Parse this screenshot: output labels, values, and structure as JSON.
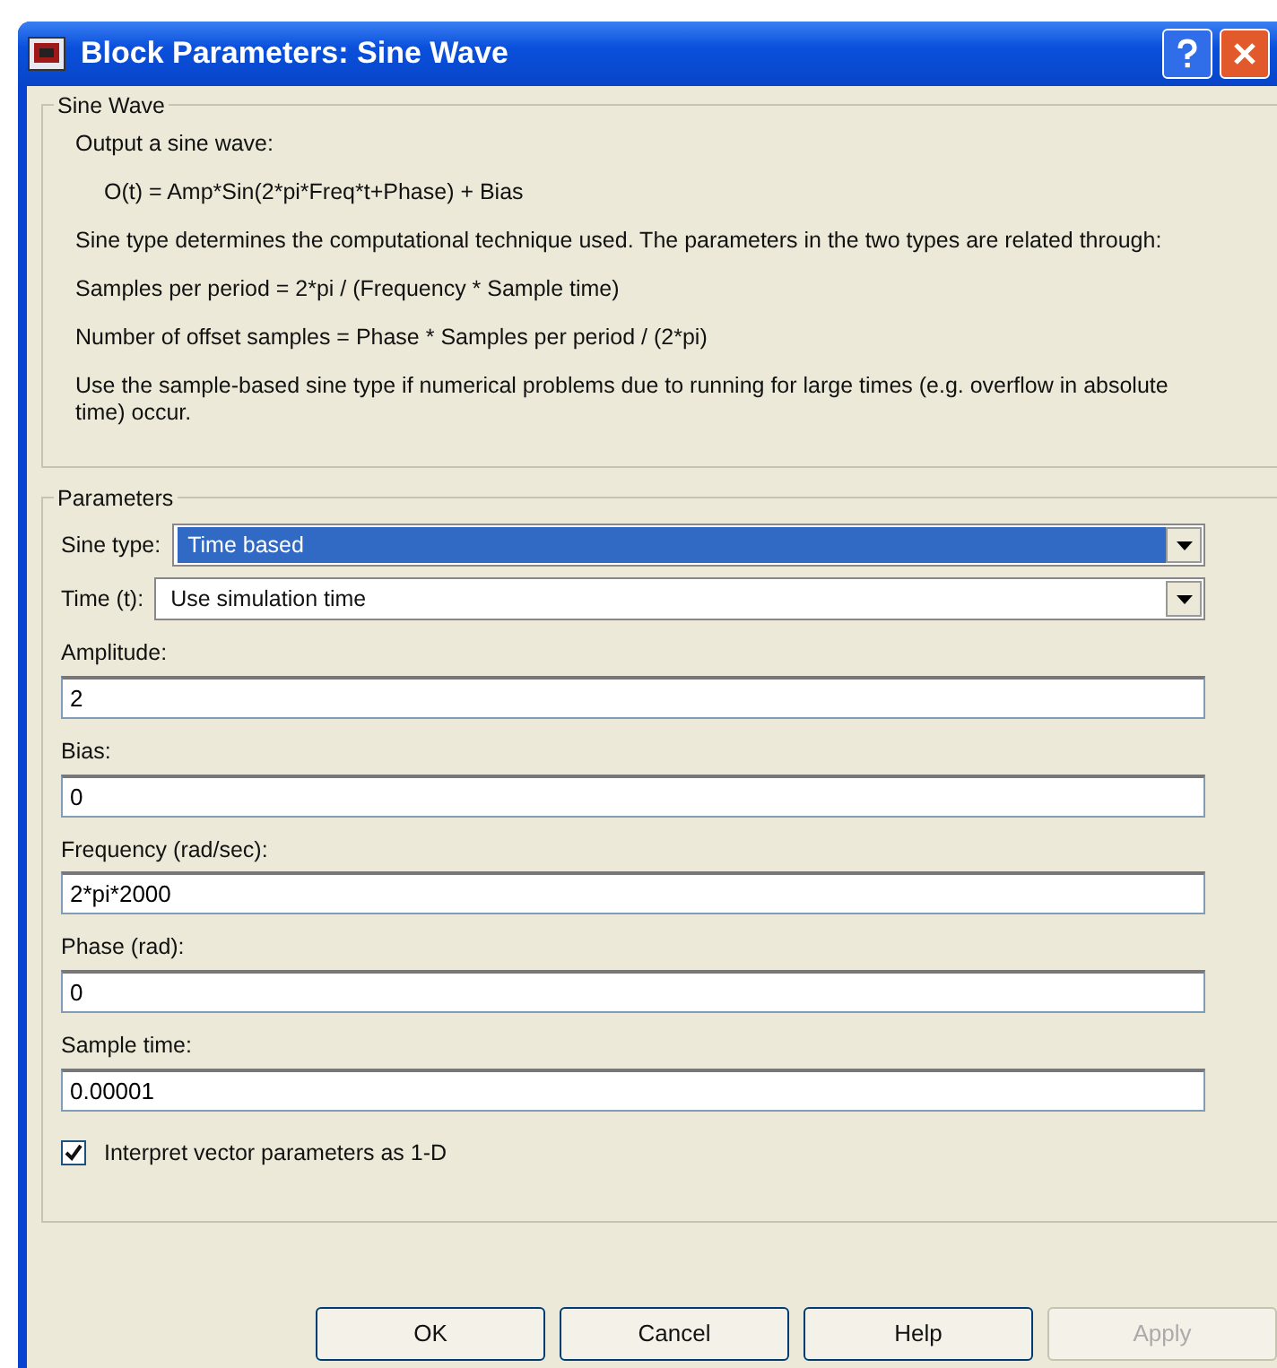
{
  "window": {
    "title": "Block Parameters: Sine Wave"
  },
  "description": {
    "title": "Sine Wave",
    "paragraphs": [
      "Output a sine wave:",
      "  O(t) = Amp*Sin(2*pi*Freq*t+Phase) + Bias",
      "Sine type determines the computational technique used. The parameters in the two types are related through:",
      "Samples per period = 2*pi / (Frequency * Sample time)",
      "Number of offset samples = Phase * Samples per period / (2*pi)",
      "Use the sample-based sine type if numerical problems due to running for large times (e.g. overflow in absolute time) occur."
    ]
  },
  "parameters": {
    "title": "Parameters",
    "items": [
      {
        "kind": "dropdown",
        "label": "Sine type:",
        "value": "Time based",
        "focused": true
      },
      {
        "kind": "dropdown",
        "label": "Time (t):",
        "value": "Use simulation time",
        "focused": false
      },
      {
        "kind": "text",
        "label": "Amplitude:",
        "value": "2"
      },
      {
        "kind": "text",
        "label": "Bias:",
        "value": "0"
      },
      {
        "kind": "text",
        "label": "Frequency (rad/sec):",
        "value": "2*pi*2000"
      },
      {
        "kind": "text",
        "label": "Phase (rad):",
        "value": "0"
      },
      {
        "kind": "text",
        "label": "Sample time:",
        "value": "0.00001"
      },
      {
        "kind": "checkbox",
        "label": "Interpret vector parameters as 1-D",
        "checked": true
      }
    ]
  },
  "buttons": [
    {
      "label": "OK",
      "disabled": false
    },
    {
      "label": "Cancel",
      "disabled": false
    },
    {
      "label": "Help",
      "disabled": false
    },
    {
      "label": "Apply",
      "disabled": true
    }
  ]
}
